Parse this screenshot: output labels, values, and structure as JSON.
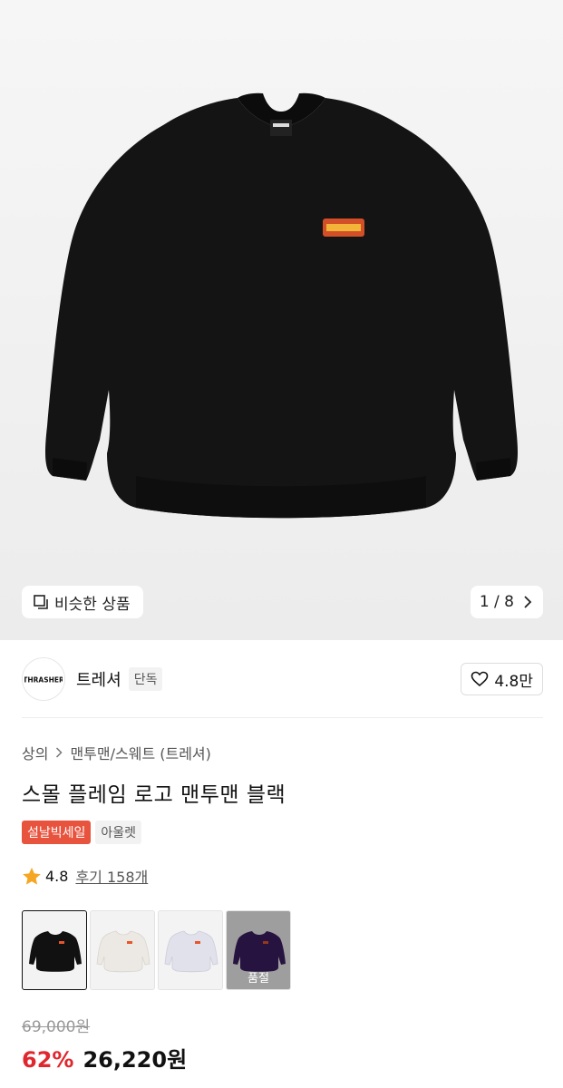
{
  "gallery": {
    "similar_label": "비슷한 상품",
    "pager": "1 / 8",
    "colors": {
      "background": "#efefef",
      "garment": "#111111",
      "logo_flame": "#e8552a"
    }
  },
  "brand": {
    "logo_text": "THRASHER",
    "name": "트레셔",
    "exclusive_badge": "단독",
    "likes": "4.8만"
  },
  "breadcrumb": {
    "category": "상의",
    "subcategory": "맨투맨/스웨트 (트레셔)"
  },
  "product": {
    "title": "스몰 플레임 로고 맨투맨 블랙",
    "tags": [
      "설날빅세일",
      "아울렛"
    ],
    "rating": "4.8",
    "reviews": "후기 158개"
  },
  "swatches": [
    {
      "color": "#111111",
      "selected": true,
      "sold_out": false
    },
    {
      "color": "#ece9e4",
      "selected": false,
      "sold_out": false
    },
    {
      "color": "#e1e1ec",
      "selected": false,
      "sold_out": false
    },
    {
      "color": "#3c1e63",
      "selected": false,
      "sold_out": true,
      "label": "품절"
    }
  ],
  "price": {
    "original": "69,000원",
    "discount": "62%",
    "sale": "26,220원",
    "discount_color": "#e0262e"
  }
}
